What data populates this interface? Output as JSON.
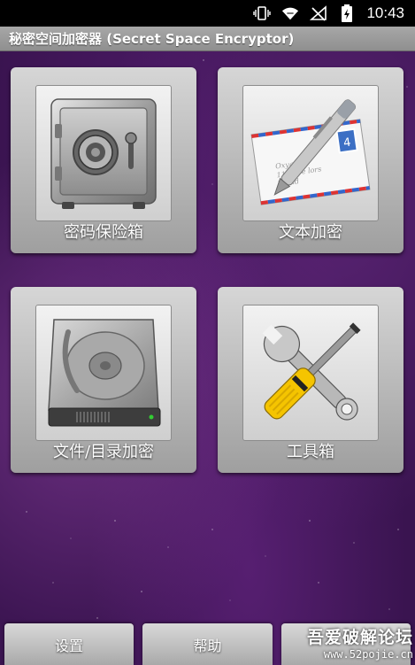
{
  "status_bar": {
    "time": "10:43",
    "icons": [
      "vibrate-icon",
      "wifi-icon",
      "no-signal-icon",
      "battery-charging-icon"
    ]
  },
  "app": {
    "title": "秘密空间加密器 (Secret Space Encryptor)"
  },
  "tiles": [
    {
      "label": "密码保险箱",
      "icon": "safe-icon"
    },
    {
      "label": "文本加密",
      "icon": "envelope-pen-icon"
    },
    {
      "label": "文件/目录加密",
      "icon": "hard-drive-icon"
    },
    {
      "label": "工具箱",
      "icon": "tools-icon"
    }
  ],
  "bottom_bar": {
    "settings_label": "设置",
    "help_label": "帮助"
  },
  "envelope": {
    "stamp_number": "4",
    "address_line1": "Oxygen",
    "address_line2": "1100 Se    lors",
    "address_line3": "World"
  },
  "watermark": {
    "line1": "吾爱破解论坛",
    "line2": "www.52pojie.cn"
  },
  "colors": {
    "background": "#3a1450",
    "titlebar": "#9a9a9a",
    "tile": "#bdbdbd"
  }
}
